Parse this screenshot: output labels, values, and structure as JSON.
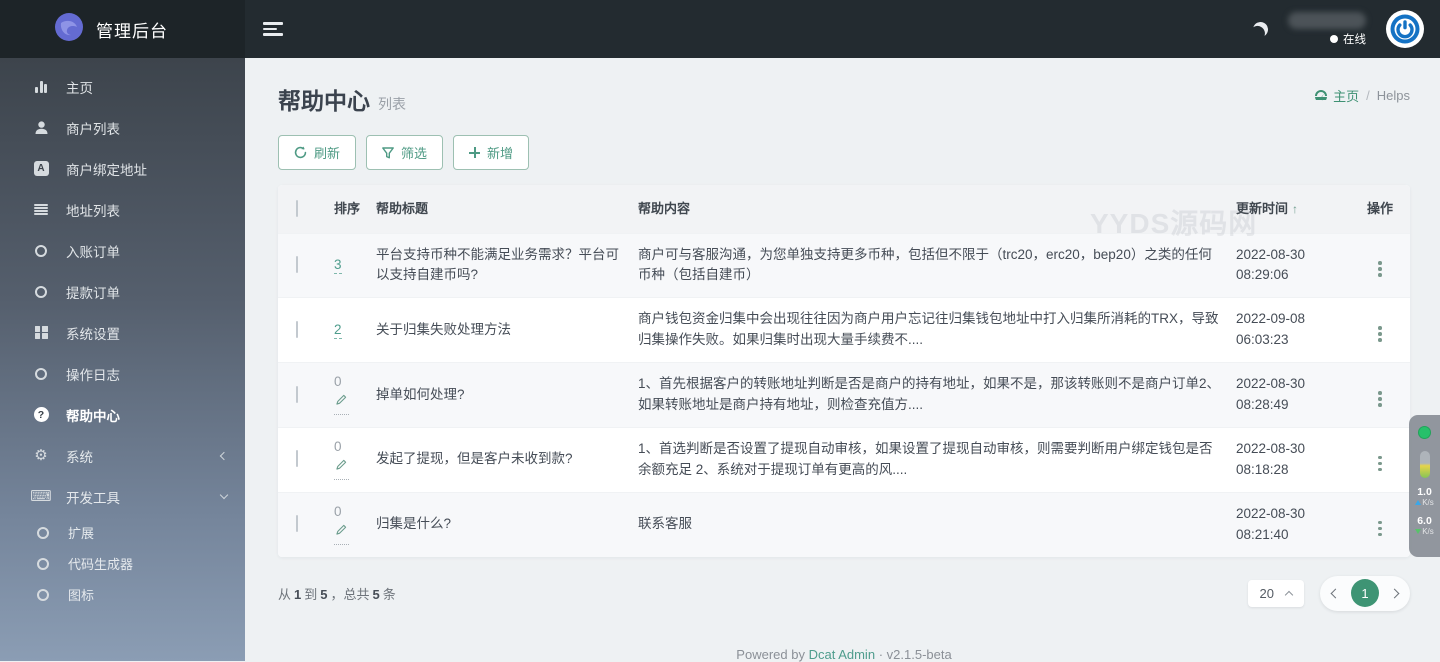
{
  "topbar": {
    "title": "管理后台",
    "online_label": "在线"
  },
  "sidebar": {
    "items": [
      {
        "label": "主页"
      },
      {
        "label": "商户列表"
      },
      {
        "label": "商户绑定地址",
        "glyph": "A"
      },
      {
        "label": "地址列表"
      },
      {
        "label": "入账订单"
      },
      {
        "label": "提款订单"
      },
      {
        "label": "系统设置"
      },
      {
        "label": "操作日志"
      },
      {
        "label": "帮助中心",
        "glyph": "?"
      },
      {
        "label": "系统"
      },
      {
        "label": "开发工具"
      },
      {
        "label": "扩展"
      },
      {
        "label": "代码生成器"
      },
      {
        "label": "图标"
      }
    ]
  },
  "icons": {
    "gear": "⚙",
    "keyboard": "⌨",
    "sort_asc": "↑"
  },
  "page": {
    "title": "帮助中心",
    "subtitle": "列表",
    "breadcrumb": {
      "home": "主页",
      "separator": "/",
      "current": "Helps"
    }
  },
  "toolbar": {
    "refresh": "刷新",
    "filter": "筛选",
    "create": "新增"
  },
  "watermark": "YYDS源码网",
  "table": {
    "headers": {
      "sort": "排序",
      "title": "帮助标题",
      "content": "帮助内容",
      "updated_at": "更新时间",
      "actions": "操作"
    },
    "rows": [
      {
        "sort": "3",
        "title": "平台支持币种不能满足业务需求？平台可以支持自建币吗?",
        "content": "商户可与客服沟通，为您单独支持更多币种，包括但不限于（trc20，erc20，bep20）之类的任何币种（包括自建币）",
        "date": "2022-08-30",
        "time": "08:29:06"
      },
      {
        "sort": "2",
        "title": "关于归集失败处理方法",
        "content": "商户钱包资金归集中会出现往往因为商户用户忘记往归集钱包地址中打入归集所消耗的TRX，导致归集操作失败。如果归集时出现大量手续费不....",
        "date": "2022-09-08",
        "time": "06:03:23"
      },
      {
        "sort": "0",
        "title": "掉单如何处理?",
        "content": "1、首先根据客户的转账地址判断是否是商户的持有地址，如果不是，那该转账则不是商户订单2、如果转账地址是商户持有地址，则检查充值方....",
        "date": "2022-08-30",
        "time": "08:28:49"
      },
      {
        "sort": "0",
        "title": "发起了提现，但是客户未收到款?",
        "content": "1、首选判断是否设置了提现自动审核，如果设置了提现自动审核，则需要判断用户绑定钱包是否余额充足 2、系统对于提现订单有更高的风....",
        "date": "2022-08-30",
        "time": "08:18:28"
      },
      {
        "sort": "0",
        "title": "归集是什么?",
        "content": "联系客服",
        "date": "2022-08-30",
        "time": "08:21:40"
      }
    ]
  },
  "pagination": {
    "from_label": "从",
    "from": "1",
    "to_label": "到",
    "to": "5",
    "total_label": "，总共",
    "total": "5",
    "unit_label": "条",
    "page_size": "20",
    "current_page": "1"
  },
  "footer": {
    "powered_by": "Powered by",
    "brand": "Dcat Admin",
    "separator": "·",
    "version": "v2.1.5-beta"
  },
  "speed": {
    "up_value": "1.0",
    "up_unit": "K/s",
    "down_value": "6.0",
    "down_unit": "K/s"
  }
}
